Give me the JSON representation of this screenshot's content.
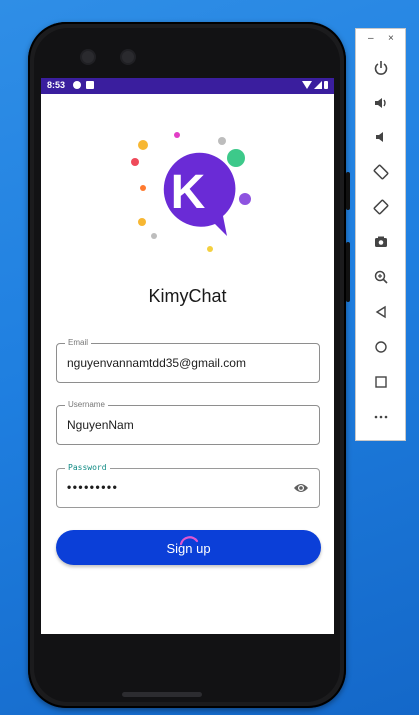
{
  "status_bar": {
    "time": "8:53"
  },
  "app": {
    "title": "KimyChat",
    "logo_letter": "K"
  },
  "form": {
    "email": {
      "label": "Email",
      "value": "nguyenvannamtdd35@gmail.com"
    },
    "username": {
      "label": "Username",
      "value": "NguyenNam"
    },
    "password": {
      "label": "Password",
      "value": "•••••••••"
    },
    "submit_label": "Sign up"
  },
  "emulator_toolbar": {
    "minimize": "–",
    "close": "×",
    "buttons": [
      "power-icon",
      "volume-up-icon",
      "volume-down-icon",
      "rotate-left-icon",
      "rotate-right-icon",
      "camera-icon",
      "zoom-icon",
      "back-icon",
      "home-icon",
      "overview-icon",
      "more-icon"
    ]
  },
  "colors": {
    "status_bar": "#3a1e9e",
    "button": "#0b3fd8",
    "logo_purple": "#6a2bd6",
    "focus_label": "#0e8a83"
  }
}
